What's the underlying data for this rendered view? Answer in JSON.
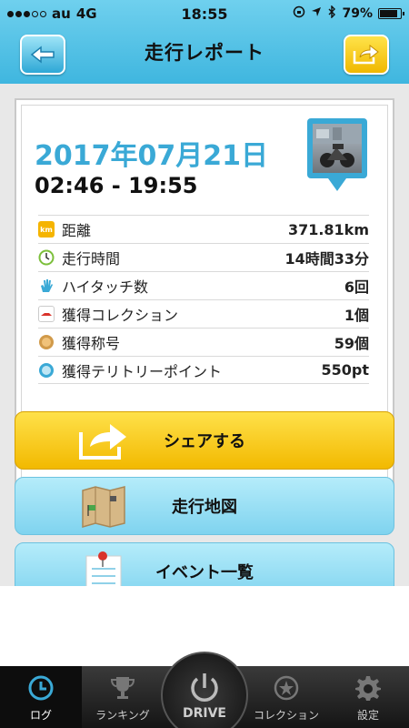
{
  "status": {
    "carrier": "au",
    "network": "4G",
    "time": "18:55",
    "battery": "79%",
    "battery_level": 0.79
  },
  "nav": {
    "title": "走行レポート",
    "back_icon": "back-arrow-icon",
    "share_icon": "share-arrow-icon"
  },
  "report": {
    "date": "2017年07月21日",
    "time_range": "02:46 - 19:55",
    "stats": [
      {
        "label": "距離",
        "value": "371.81km",
        "icon": "km-icon",
        "color": "#f5b400"
      },
      {
        "label": "走行時間",
        "value": "14時間33分",
        "icon": "clock-icon",
        "color": "#7cbf3b"
      },
      {
        "label": "ハイタッチ数",
        "value": "6回",
        "icon": "hand-icon",
        "color": "#3aa9d6"
      },
      {
        "label": "獲得コレクション",
        "value": "1個",
        "icon": "card-icon",
        "color": "#d9332b"
      },
      {
        "label": "獲得称号",
        "value": "59個",
        "icon": "medal-icon",
        "color": "#d19a4a"
      },
      {
        "label": "獲得テリトリーポイント",
        "value": "550pt",
        "icon": "spot-icon",
        "color": "#3aa9d6"
      }
    ]
  },
  "actions": {
    "share": "シェアする",
    "map": "走行地図",
    "events": "イベント一覧"
  },
  "tabs": {
    "log": "ログ",
    "ranking": "ランキング",
    "drive": "DRIVE",
    "collection": "コレクション",
    "settings": "設定"
  },
  "colors": {
    "accent_blue": "#3aa9d6",
    "accent_yellow": "#f2b900"
  }
}
